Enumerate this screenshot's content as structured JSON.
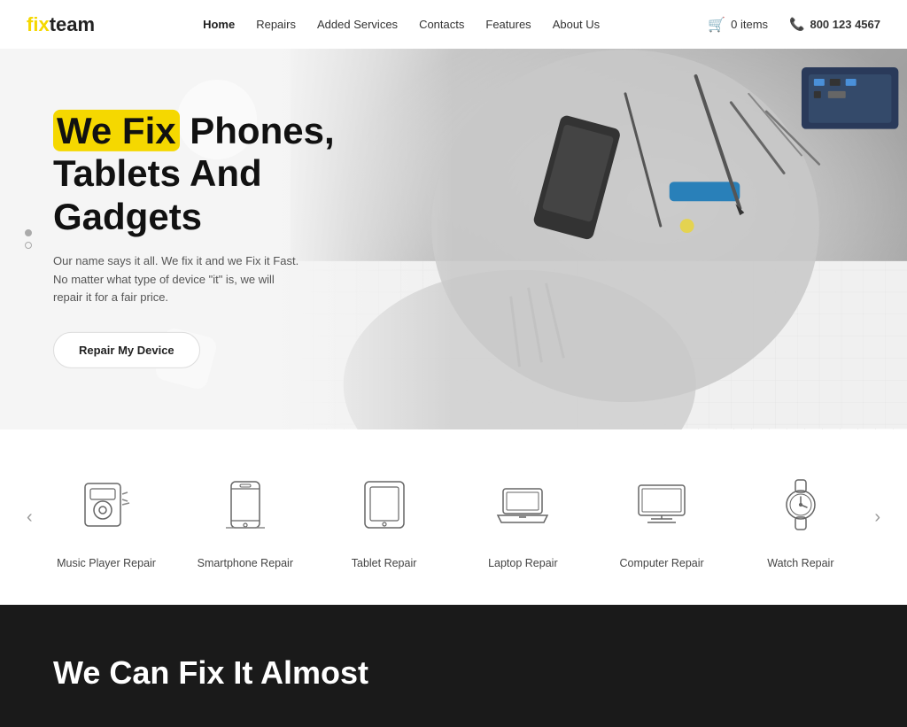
{
  "header": {
    "logo_prefix": "fix",
    "logo_suffix": "team",
    "nav": [
      {
        "label": "Home",
        "active": true
      },
      {
        "label": "Repairs",
        "active": false
      },
      {
        "label": "Added Services",
        "active": false
      },
      {
        "label": "Contacts",
        "active": false
      },
      {
        "label": "Features",
        "active": false
      },
      {
        "label": "About Us",
        "active": false
      }
    ],
    "cart_label": "0 items",
    "phone_label": "800 123 4567"
  },
  "hero": {
    "title_highlight": "We Fix",
    "title_rest": " Phones,",
    "title_line2": "Tablets And",
    "title_line3": "Gadgets",
    "description": "Our name says it all. We fix it and we Fix it Fast. No matter what type of device \"it\" is, we will repair it for a fair price.",
    "cta_label": "Repair My Device"
  },
  "services": {
    "items": [
      {
        "id": "music-player",
        "label": "Music Player Repair",
        "icon": "music-player-icon"
      },
      {
        "id": "smartphone",
        "label": "Smartphone Repair",
        "icon": "smartphone-icon"
      },
      {
        "id": "tablet",
        "label": "Tablet Repair",
        "icon": "tablet-icon"
      },
      {
        "id": "laptop",
        "label": "Laptop Repair",
        "icon": "laptop-icon"
      },
      {
        "id": "computer",
        "label": "Computer Repair",
        "icon": "computer-icon"
      },
      {
        "id": "watch",
        "label": "Watch Repair",
        "icon": "watch-icon"
      }
    ],
    "prev_label": "‹",
    "next_label": "›"
  },
  "dark_section": {
    "title": "We Can Fix It Almost"
  },
  "colors": {
    "accent": "#f5d800",
    "dark_bg": "#1a1a1a",
    "nav_active": "#222"
  }
}
